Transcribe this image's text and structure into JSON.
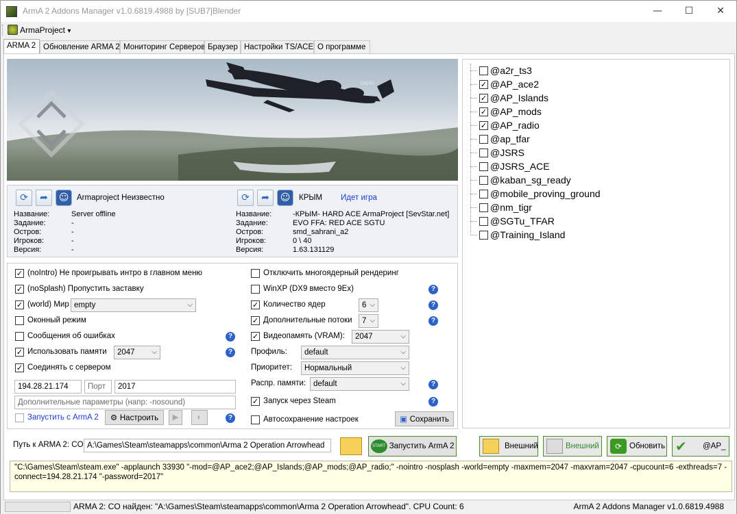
{
  "window": {
    "title": "ArmA 2 Addons Manager v1.0.6819.4988 by [SUB7]Blender",
    "minimize": "—",
    "maximize": "☐",
    "close": "✕"
  },
  "menu": {
    "project": "ArmaProject",
    "arrow": "▾"
  },
  "tabs": [
    "ARMA 2",
    "Обновление ARMA 2",
    "Мониторинг Серверов",
    "Браузер",
    "Настройки TS/ACE",
    "О программе"
  ],
  "server_left": {
    "name": "Armaproject Неизвестно",
    "labels": [
      "Название:",
      "Задание:",
      "Остров:",
      "Игроков:",
      "Версия:"
    ],
    "values": [
      "Server offline",
      "-",
      "-",
      "-",
      "-"
    ]
  },
  "server_right": {
    "name": "КРЫМ",
    "status": "Идет игра",
    "labels": [
      "Название:",
      "Задание:",
      "Остров:",
      "Игроков:",
      "Версия:"
    ],
    "values": [
      "-КРЫМ- HARD ACE ArmaProject [SevStar.net]",
      "EVO FFA: RED ACE SGTU",
      "smd_sahrani_a2",
      "0 \\ 40",
      "1.63.131129"
    ]
  },
  "banner_watermark": "окно",
  "options_left": {
    "nointro": "(noIntro) Не проигрывать интро в главном меню",
    "nosplash": "(noSplash) Пропустить заставку",
    "world": "(world) Мир",
    "world_value": "empty",
    "windowed": "Оконный режим",
    "errors": "Сообщения об ошибках",
    "memory": "Использовать памяти",
    "memory_value": "2047",
    "connect": "Соединять с сервером",
    "ip": "194.28.21.174",
    "port_placeholder": "Порт",
    "port": "2017",
    "extra_placeholder": "Дополнительные параметры (напр: -nosound)",
    "launch_arma2": "Запустить с ArmA 2",
    "configure": "Настроить"
  },
  "options_right": {
    "multicore": "Отключить многоядерный рендеринг",
    "winxp": "WinXP (DX9 вместо 9Ex)",
    "cores": "Количество ядер",
    "cores_value": "6",
    "threads": "Дополнительные потоки",
    "threads_value": "7",
    "vram": "Видеопамять (VRAM):",
    "vram_value": "2047",
    "profile": "Профиль:",
    "profile_value": "default",
    "priority": "Приоритет:",
    "priority_value": "Нормальный",
    "memalloc": "Распр. памяти:",
    "memalloc_value": "default",
    "steam": "Запуск  через Steam",
    "autosave": "Автосохранение настроек",
    "save": "Сохранить"
  },
  "mods": [
    {
      "name": "@a2r_ts3",
      "checked": false
    },
    {
      "name": "@AP_ace2",
      "checked": true
    },
    {
      "name": "@AP_Islands",
      "checked": true
    },
    {
      "name": "@AP_mods",
      "checked": true
    },
    {
      "name": "@AP_radio",
      "checked": true
    },
    {
      "name": "@ap_tfar",
      "checked": false
    },
    {
      "name": "@JSRS",
      "checked": false
    },
    {
      "name": "@JSRS_ACE",
      "checked": false
    },
    {
      "name": "@kaban_sg_ready",
      "checked": false
    },
    {
      "name": "@mobile_proving_ground",
      "checked": false
    },
    {
      "name": "@nm_tigr",
      "checked": false
    },
    {
      "name": "@SGTu_TFAR",
      "checked": false
    },
    {
      "name": "@Training_Island",
      "checked": false
    }
  ],
  "path": {
    "label": "Путь к ARMA 2: CO:",
    "value": "A:\\Games\\Steam\\steamapps\\common\\Arma 2 Operation Arrowhead",
    "launch": "Запустить ArmA 2",
    "start_badge": "START"
  },
  "actions": {
    "external1": "Внешний",
    "external2": "Внешний",
    "refresh": "Обновить",
    "ap": "@AP_"
  },
  "cmdline": "\"C:\\Games\\Steam\\steam.exe\" -applaunch 33930 \"-mod=@AP_ace2;@AP_Islands;@AP_mods;@AP_radio;\" -nointro -nosplash -world=empty -maxmem=2047 -maxvram=2047 -cpucount=6 -exthreads=7 -connect=194.28.21.174 \"-password=2017\"",
  "status": {
    "main": "ARMA 2: CO найден: \"A:\\Games\\Steam\\steamapps\\common\\Arma 2 Operation Arrowhead\". CPU Count: 6",
    "right": "ArmA 2 Addons Manager v1.0.6819.4988"
  },
  "colors": {
    "link": "#1a3cd0",
    "help": "#2d62c8",
    "cmd_bg": "#ffffe5",
    "green": "#3a9a22"
  }
}
